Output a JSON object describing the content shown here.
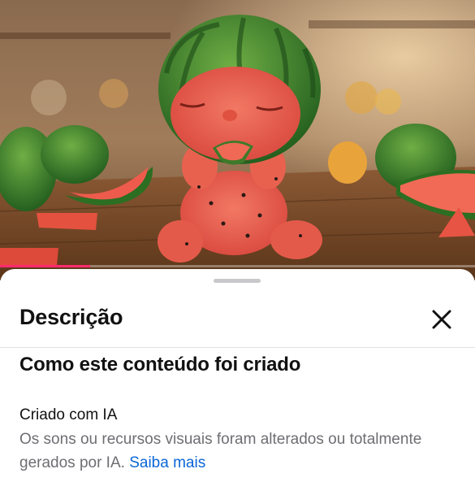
{
  "media": {
    "description_image": "watermelon-baby-figure",
    "progress_percent": 19,
    "accent_color": "#ff2a6d"
  },
  "sheet": {
    "title": "Descrição",
    "close_icon": "close-icon",
    "section_heading": "Como este conteúdo foi criado",
    "item": {
      "title": "Criado com IA",
      "description": "Os sons ou recursos visuais foram alterados ou totalmente gerados por IA. ",
      "learn_more": "Saiba mais",
      "link_color": "#0a66d6"
    }
  }
}
